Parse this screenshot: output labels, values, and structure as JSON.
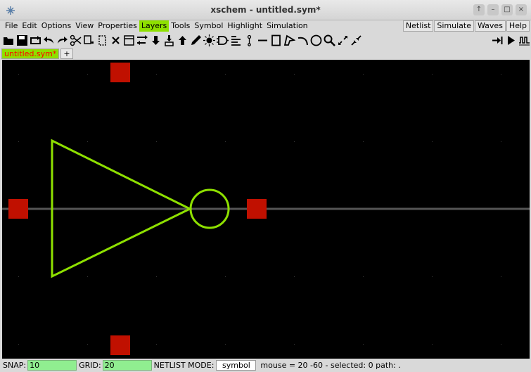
{
  "window": {
    "title": "xschem - untitled.sym*",
    "buttons": [
      "↑",
      "–",
      "□",
      "×"
    ]
  },
  "menu": {
    "items": [
      "File",
      "Edit",
      "Options",
      "View",
      "Properties",
      "Layers",
      "Tools",
      "Symbol",
      "Highlight",
      "Simulation"
    ],
    "active": "Layers",
    "right_buttons": [
      "Netlist",
      "Simulate",
      "Waves",
      "Help"
    ]
  },
  "toolbar": {
    "icons": [
      "open-icon",
      "save-icon",
      "reload-icon",
      "undo-icon",
      "redo-icon",
      "cut-icon",
      "copy-icon",
      "paste-icon",
      "delete-icon",
      "select-all-icon",
      "move-icon",
      "push-icon",
      "descend-icon",
      "pop-icon",
      "pen-icon",
      "lamp-icon",
      "gate-icon",
      "text-lines-icon",
      "pin-icon",
      "line-icon",
      "rect-icon",
      "polygon-icon",
      "arc-icon",
      "circle-icon",
      "search-icon",
      "zoom-in-icon",
      "zoom-out-icon"
    ],
    "right_icons": [
      "netlist-icon",
      "simulate-icon",
      "waves-icon"
    ]
  },
  "tabs": [
    {
      "label": "untitled.sym*",
      "active": true
    },
    {
      "label": "+",
      "active": false
    }
  ],
  "colors": {
    "canvas_bg": "#000000",
    "symbol_line": "#8ee000",
    "pin_box": "#c01000",
    "axis": "#555555",
    "grid_dot": "#3a3a3a"
  },
  "status": {
    "snap_label": "SNAP:",
    "snap_value": "10",
    "grid_label": "GRID:",
    "grid_value": "20",
    "mode_label": "NETLIST MODE:",
    "mode_value": "symbol",
    "info": "mouse = 20 -60 - selected: 0 path: ."
  }
}
